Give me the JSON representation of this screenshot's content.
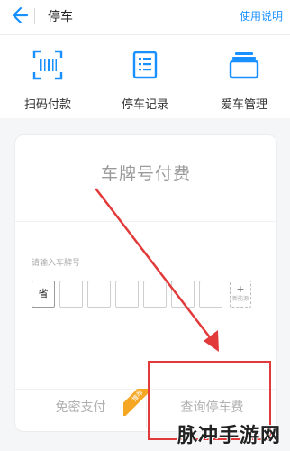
{
  "header": {
    "title": "停车",
    "help_label": "使用说明",
    "back_icon": "back-arrow-icon"
  },
  "quick_actions": [
    {
      "label": "扫码付款",
      "icon": "scan-icon"
    },
    {
      "label": "停车记录",
      "icon": "list-doc-icon"
    },
    {
      "label": "爱车管理",
      "icon": "card-stack-icon"
    }
  ],
  "card": {
    "title": "车牌号付费",
    "plate_hint": "请输入车牌号",
    "province": "省",
    "new_energy_plus": "+",
    "new_energy_label": "新能源",
    "left_button": "免密支付",
    "right_button": "查询停车费",
    "badge": "推荐"
  },
  "watermark": "脉冲手游网",
  "colors": {
    "accent": "#1890ff",
    "annotation": "#e23a3a",
    "badge": "#f5a623"
  }
}
